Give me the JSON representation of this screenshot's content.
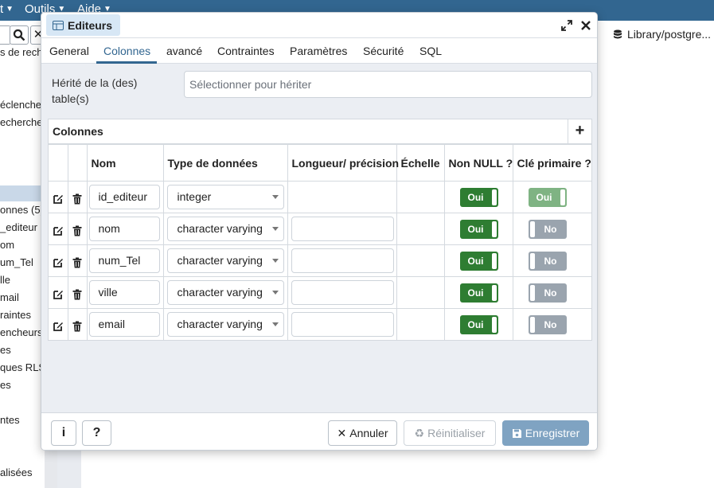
{
  "app": {
    "menu": [
      "t",
      "Outils",
      "Aide"
    ],
    "library_path": "Library/postgre...",
    "tree_items": [
      "s de rech",
      "éclenche",
      "echerche",
      "onnes (5)",
      "_editeur",
      "om",
      "um_Tel",
      "lle",
      "mail",
      "raintes",
      "encheurs",
      "es",
      "ques RLS",
      "es",
      "ntes",
      "alisées"
    ]
  },
  "dialog": {
    "title": "Editeurs",
    "tabs": [
      "General",
      "Colonnes",
      "avancé",
      "Contraintes",
      "Paramètres",
      "Sécurité",
      "SQL"
    ],
    "active_tab": "Colonnes",
    "inherit_label": "Hérité de la (des) table(s)",
    "inherit_placeholder": "Sélectionner pour hériter",
    "columns_title": "Colonnes",
    "add_label": "+",
    "headers": [
      "Nom",
      "Type de données",
      "Longueur/ précision",
      "Échelle",
      "Non NULL ?",
      "Clé primaire ?"
    ],
    "rows": [
      {
        "name": "id_editeur",
        "type": "integer",
        "not_null": "Oui",
        "primary_key": "Oui"
      },
      {
        "name": "nom",
        "type": "character varying",
        "not_null": "Oui",
        "primary_key": "No"
      },
      {
        "name": "num_Tel",
        "type": "character varying",
        "not_null": "Oui",
        "primary_key": "No"
      },
      {
        "name": "ville",
        "type": "character varying",
        "not_null": "Oui",
        "primary_key": "No"
      },
      {
        "name": "email",
        "type": "character varying",
        "not_null": "Oui",
        "primary_key": "No"
      }
    ],
    "footer": {
      "info_label": "i",
      "help_label": "?",
      "cancel_label": "Annuler",
      "reset_label": "Réinitialiser",
      "save_label": "Enregistrer"
    }
  }
}
